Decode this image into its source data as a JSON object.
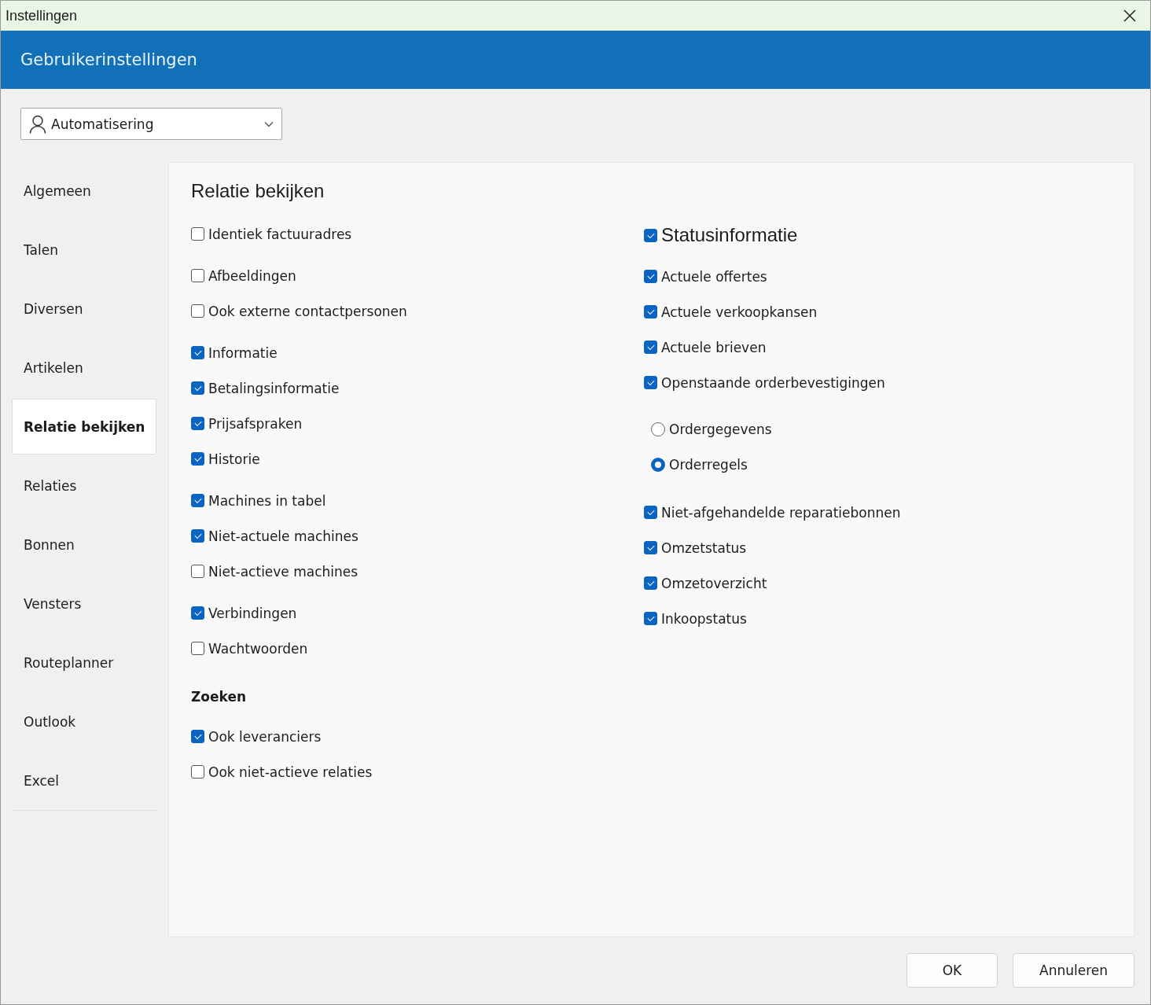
{
  "window": {
    "title": "Instellingen"
  },
  "header": {
    "title": "Gebruikerinstellingen"
  },
  "user_select": {
    "value": "Automatisering"
  },
  "sidebar": {
    "items": [
      {
        "label": "Algemeen",
        "selected": false
      },
      {
        "label": "Talen",
        "selected": false
      },
      {
        "label": "Diversen",
        "selected": false
      },
      {
        "label": "Artikelen",
        "selected": false
      },
      {
        "label": "Relatie bekijken",
        "selected": true
      },
      {
        "label": "Relaties",
        "selected": false
      },
      {
        "label": "Bonnen",
        "selected": false
      },
      {
        "label": "Vensters",
        "selected": false
      },
      {
        "label": "Routeplanner",
        "selected": false
      },
      {
        "label": "Outlook",
        "selected": false
      },
      {
        "label": "Excel",
        "selected": false
      }
    ]
  },
  "panel": {
    "title": "Relatie bekijken",
    "left": [
      {
        "kind": "checks",
        "items": [
          {
            "label": "Identiek factuuradres",
            "checked": false
          }
        ]
      },
      {
        "kind": "checks",
        "items": [
          {
            "label": "Afbeeldingen",
            "checked": false
          },
          {
            "label": "Ook externe contactpersonen",
            "checked": false
          }
        ]
      },
      {
        "kind": "checks",
        "items": [
          {
            "label": "Informatie",
            "checked": true
          },
          {
            "label": "Betalingsinformatie",
            "checked": true
          },
          {
            "label": "Prijsafspraken",
            "checked": true
          },
          {
            "label": "Historie",
            "checked": true
          }
        ]
      },
      {
        "kind": "checks",
        "items": [
          {
            "label": "Machines in tabel",
            "checked": true
          },
          {
            "label": "Niet-actuele machines",
            "checked": true
          },
          {
            "label": "Niet-actieve machines",
            "checked": false
          }
        ]
      },
      {
        "kind": "checks",
        "items": [
          {
            "label": "Verbindingen",
            "checked": true
          },
          {
            "label": "Wachtwoorden",
            "checked": false
          }
        ]
      },
      {
        "kind": "heading",
        "label": "Zoeken"
      },
      {
        "kind": "checks",
        "items": [
          {
            "label": "Ook leveranciers",
            "checked": true
          },
          {
            "label": "Ook niet-actieve relaties",
            "checked": false
          }
        ]
      }
    ],
    "right": [
      {
        "kind": "big_check",
        "label": "Statusinformatie",
        "checked": true
      },
      {
        "kind": "checks",
        "items": [
          {
            "label": "Actuele offertes",
            "checked": true
          },
          {
            "label": "Actuele verkoopkansen",
            "checked": true
          },
          {
            "label": "Actuele brieven",
            "checked": true
          },
          {
            "label": "Openstaande orderbevestigingen",
            "checked": true
          }
        ]
      },
      {
        "kind": "radios",
        "items": [
          {
            "label": "Ordergegevens",
            "selected": false
          },
          {
            "label": "Orderregels",
            "selected": true
          }
        ]
      },
      {
        "kind": "checks",
        "items": [
          {
            "label": "Niet-afgehandelde reparatiebonnen",
            "checked": true
          },
          {
            "label": "Omzetstatus",
            "checked": true
          },
          {
            "label": "Omzetoverzicht",
            "checked": true
          },
          {
            "label": "Inkoopstatus",
            "checked": true
          }
        ]
      }
    ]
  },
  "buttons": [
    {
      "label": "OK"
    },
    {
      "label": "Annuleren"
    }
  ]
}
